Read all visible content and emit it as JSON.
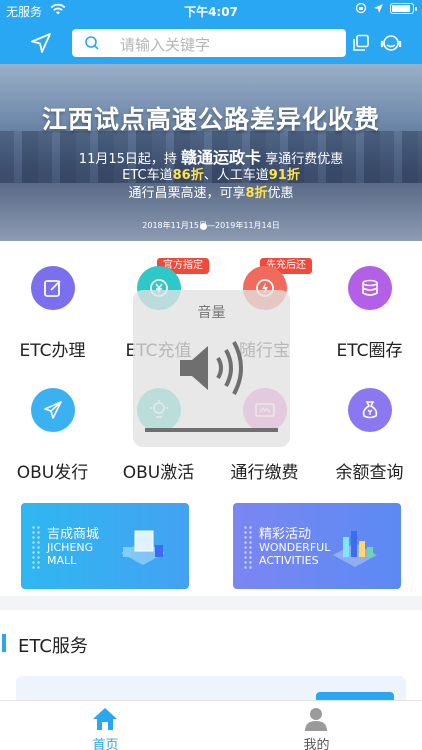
{
  "status_bar": {
    "carrier": "无服务",
    "time": "下午4:07"
  },
  "header": {
    "search_placeholder": "请输入关键字"
  },
  "banner": {
    "title": "江西试点高速公路差异化收费",
    "line1_prefix": "11月15日起，持",
    "line1_card": "赣通运政卡",
    "line1_suffix": "享通行费优惠",
    "line2_prefix": "ETC车道",
    "line2_etc_discount": "86折",
    "line2_mid": "、人工车道",
    "line2_manual_discount": "91折",
    "line3_prefix": "通行昌栗高速，可享",
    "line3_discount": "8折",
    "line3_suffix": "优惠",
    "date_range": "2018年11月15日—2019年11月14日"
  },
  "grid": [
    {
      "label": "ETC办理",
      "color": "#7b6ff0",
      "icon": "edit-icon"
    },
    {
      "label": "ETC充值",
      "color": "#2fc8c9",
      "icon": "yuan-refresh-icon",
      "tag": "官方指定"
    },
    {
      "label": "随行宝",
      "color": "#f26a5b",
      "icon": "lightning-icon",
      "tag": "先充后还"
    },
    {
      "label": "ETC圈存",
      "color": "#b45fe8",
      "icon": "coins-icon"
    },
    {
      "label": "OBU发行",
      "color": "#3ab2f2",
      "icon": "paper-plane-icon"
    },
    {
      "label": "OBU激活",
      "color": "#36d2c2",
      "icon": "bulb-icon"
    },
    {
      "label": "通行缴费",
      "color": "#e879c9",
      "icon": "card-icon"
    },
    {
      "label": "余额查询",
      "color": "#8b78f0",
      "icon": "money-bag-icon"
    }
  ],
  "cards": [
    {
      "title": "吉成商城",
      "en_line1": "JICHENG",
      "en_line2": "MALL",
      "color_from": "#2fb7f0",
      "color_to": "#43a2f3"
    },
    {
      "title": "精彩活动",
      "en_line1": "WONDERFUL",
      "en_line2": "ACTIVITIES",
      "color_from": "#7b86f2",
      "color_to": "#5b8af3"
    }
  ],
  "section": {
    "title": "ETC服务"
  },
  "volume": {
    "title": "音量"
  },
  "tabs": [
    {
      "label": "首页",
      "active": true,
      "color": "#29a7f2"
    },
    {
      "label": "我的",
      "active": false,
      "color": "#8a8a8a"
    }
  ]
}
